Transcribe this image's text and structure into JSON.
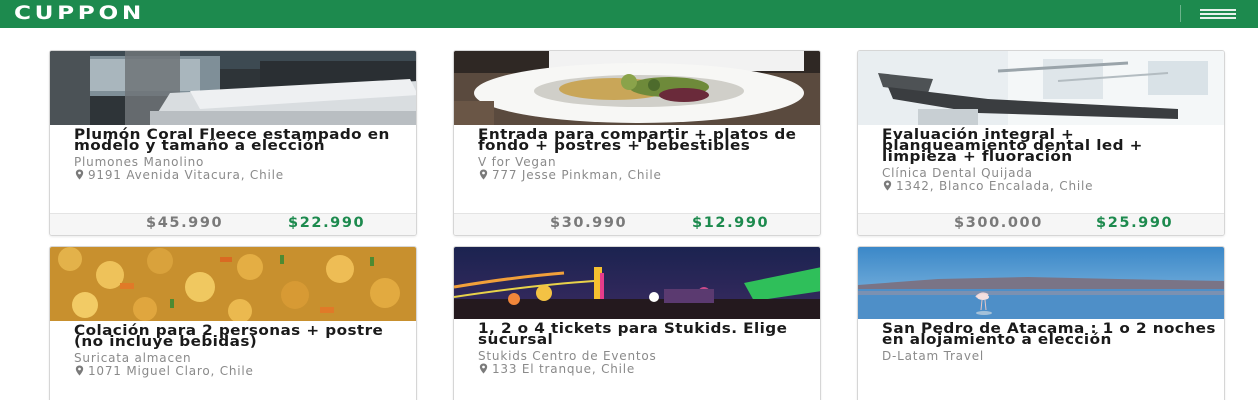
{
  "header": {
    "logo_text": "CUPPON",
    "menu_icon": "hamburger-menu-icon",
    "brand_color": "#1d8a4e"
  },
  "deals": [
    {
      "title": "Plumón Coral Fleece estampado en modelo y tamaño a elección",
      "merchant": "Plumones Manolino",
      "address": "9191 Avenida Vitacura, Chile",
      "price_original": "$45.990",
      "price_deal": "$22.990",
      "image": "bedroom-bed-photo"
    },
    {
      "title": "Entrada para compartir + platos de fondo + postres + bebestibles",
      "merchant": "V for Vegan",
      "address": "777 Jesse Pinkman, Chile",
      "price_original": "$30.990",
      "price_deal": "$12.990",
      "image": "vegan-salad-plate-photo"
    },
    {
      "title": "Evaluación integral + blanqueamiento dental led + limpieza + fluoración",
      "merchant": "Clínica Dental Quijada",
      "address": "1342, Blanco Encalada, Chile",
      "price_original": "$300.000",
      "price_deal": "$25.990",
      "image": "dental-chair-photo"
    },
    {
      "title": "Colación para 2 personas + postre (no incluye bebidas)",
      "merchant": "Suricata almacen",
      "address": "1071 Miguel Claro, Chile",
      "image": "food-dish-photo"
    },
    {
      "title": "1, 2 o 4 tickets para Stukids. Elige sucursal",
      "merchant": "Stukids Centro de Eventos",
      "address": "133 El tranque, Chile",
      "image": "amusement-park-night-photo"
    },
    {
      "title": "San Pedro de Atacama : 1 o 2 noches en alojamiento a elección",
      "merchant": "D-Latam Travel",
      "image": "atacama-lagoon-flamingo-photo"
    }
  ]
}
